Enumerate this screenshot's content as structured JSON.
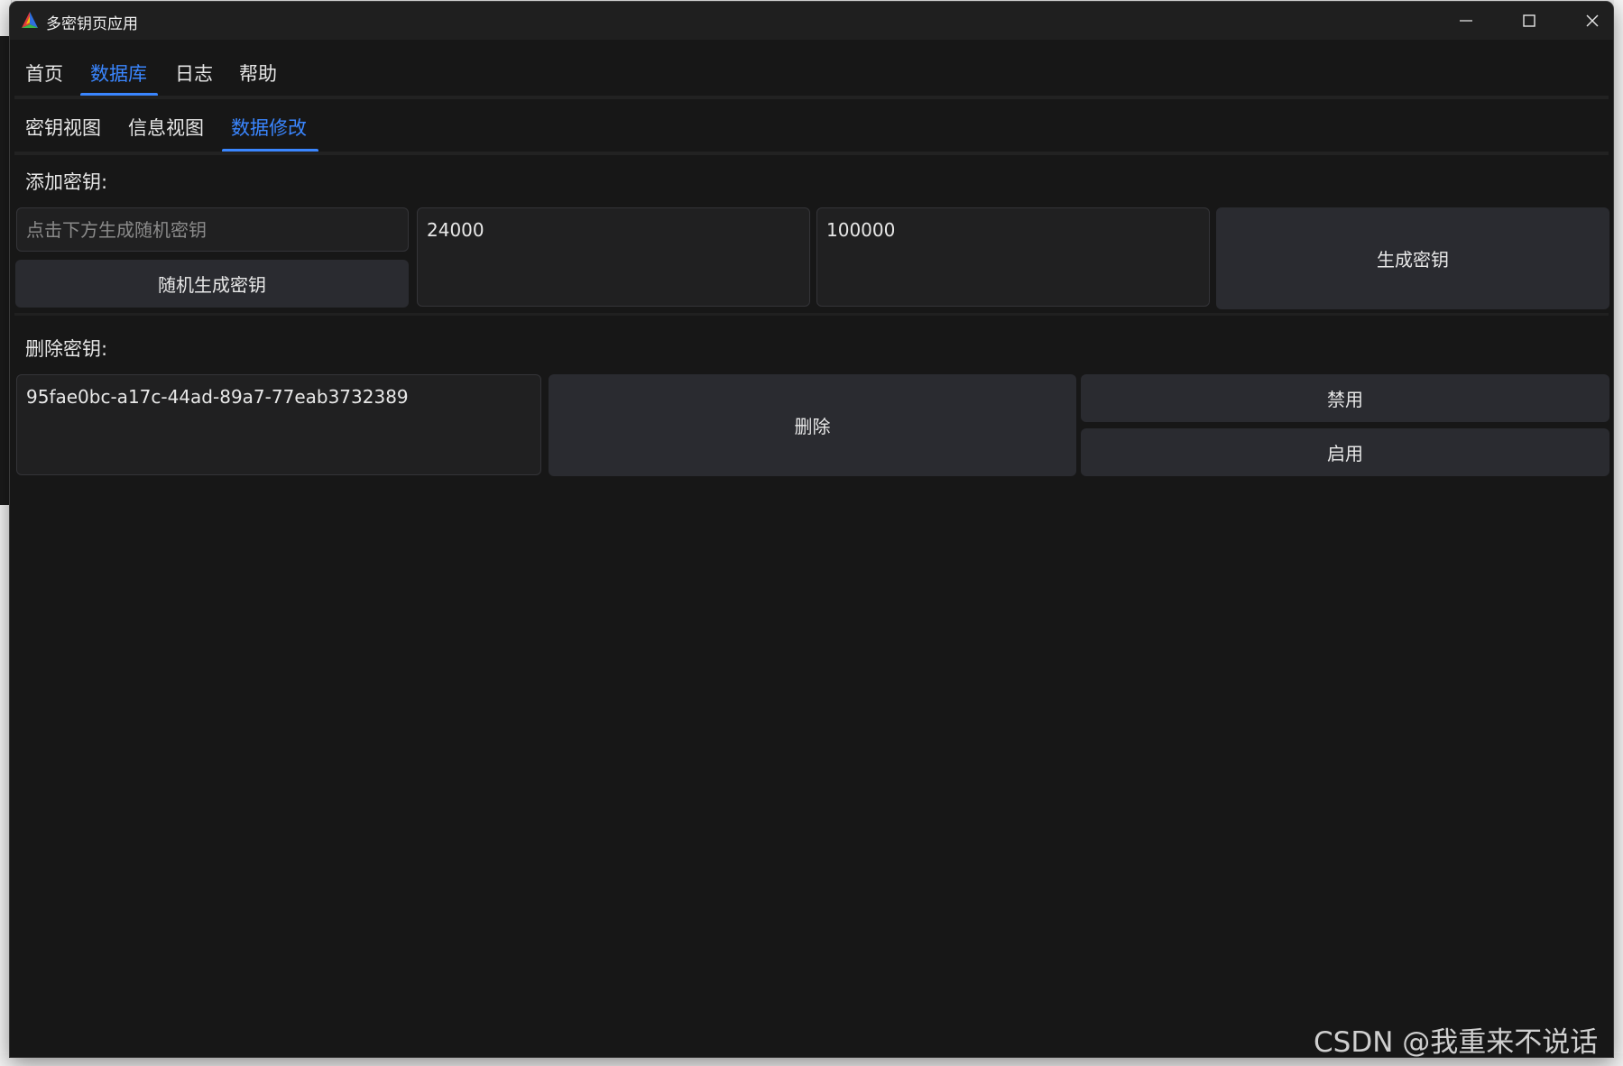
{
  "window": {
    "title": "多密钥页应用"
  },
  "menu": {
    "items": [
      "首页",
      "数据库",
      "日志",
      "帮助"
    ],
    "active_index": 1
  },
  "tabs": {
    "items": [
      "密钥视图",
      "信息视图",
      "数据修改"
    ],
    "active_index": 2
  },
  "add_section": {
    "label": "添加密钥:",
    "key_placeholder": "点击下方生成随机密钥",
    "key_value": "",
    "random_button": "随机生成密钥",
    "value_1": "24000",
    "value_2": "100000",
    "generate_button": "生成密钥"
  },
  "delete_section": {
    "label": "删除密钥:",
    "key_value": "95fae0bc-a17c-44ad-89a7-77eab3732389",
    "delete_button": "删除",
    "disable_button": "禁用",
    "enable_button": "启用"
  },
  "watermark": "CSDN @我重来不说话",
  "colors": {
    "accent": "#3a86ff",
    "window_bg": "#171717",
    "titlebar_bg": "#1f1f1f",
    "button_bg": "#2a2b30",
    "input_bg": "#202021"
  }
}
